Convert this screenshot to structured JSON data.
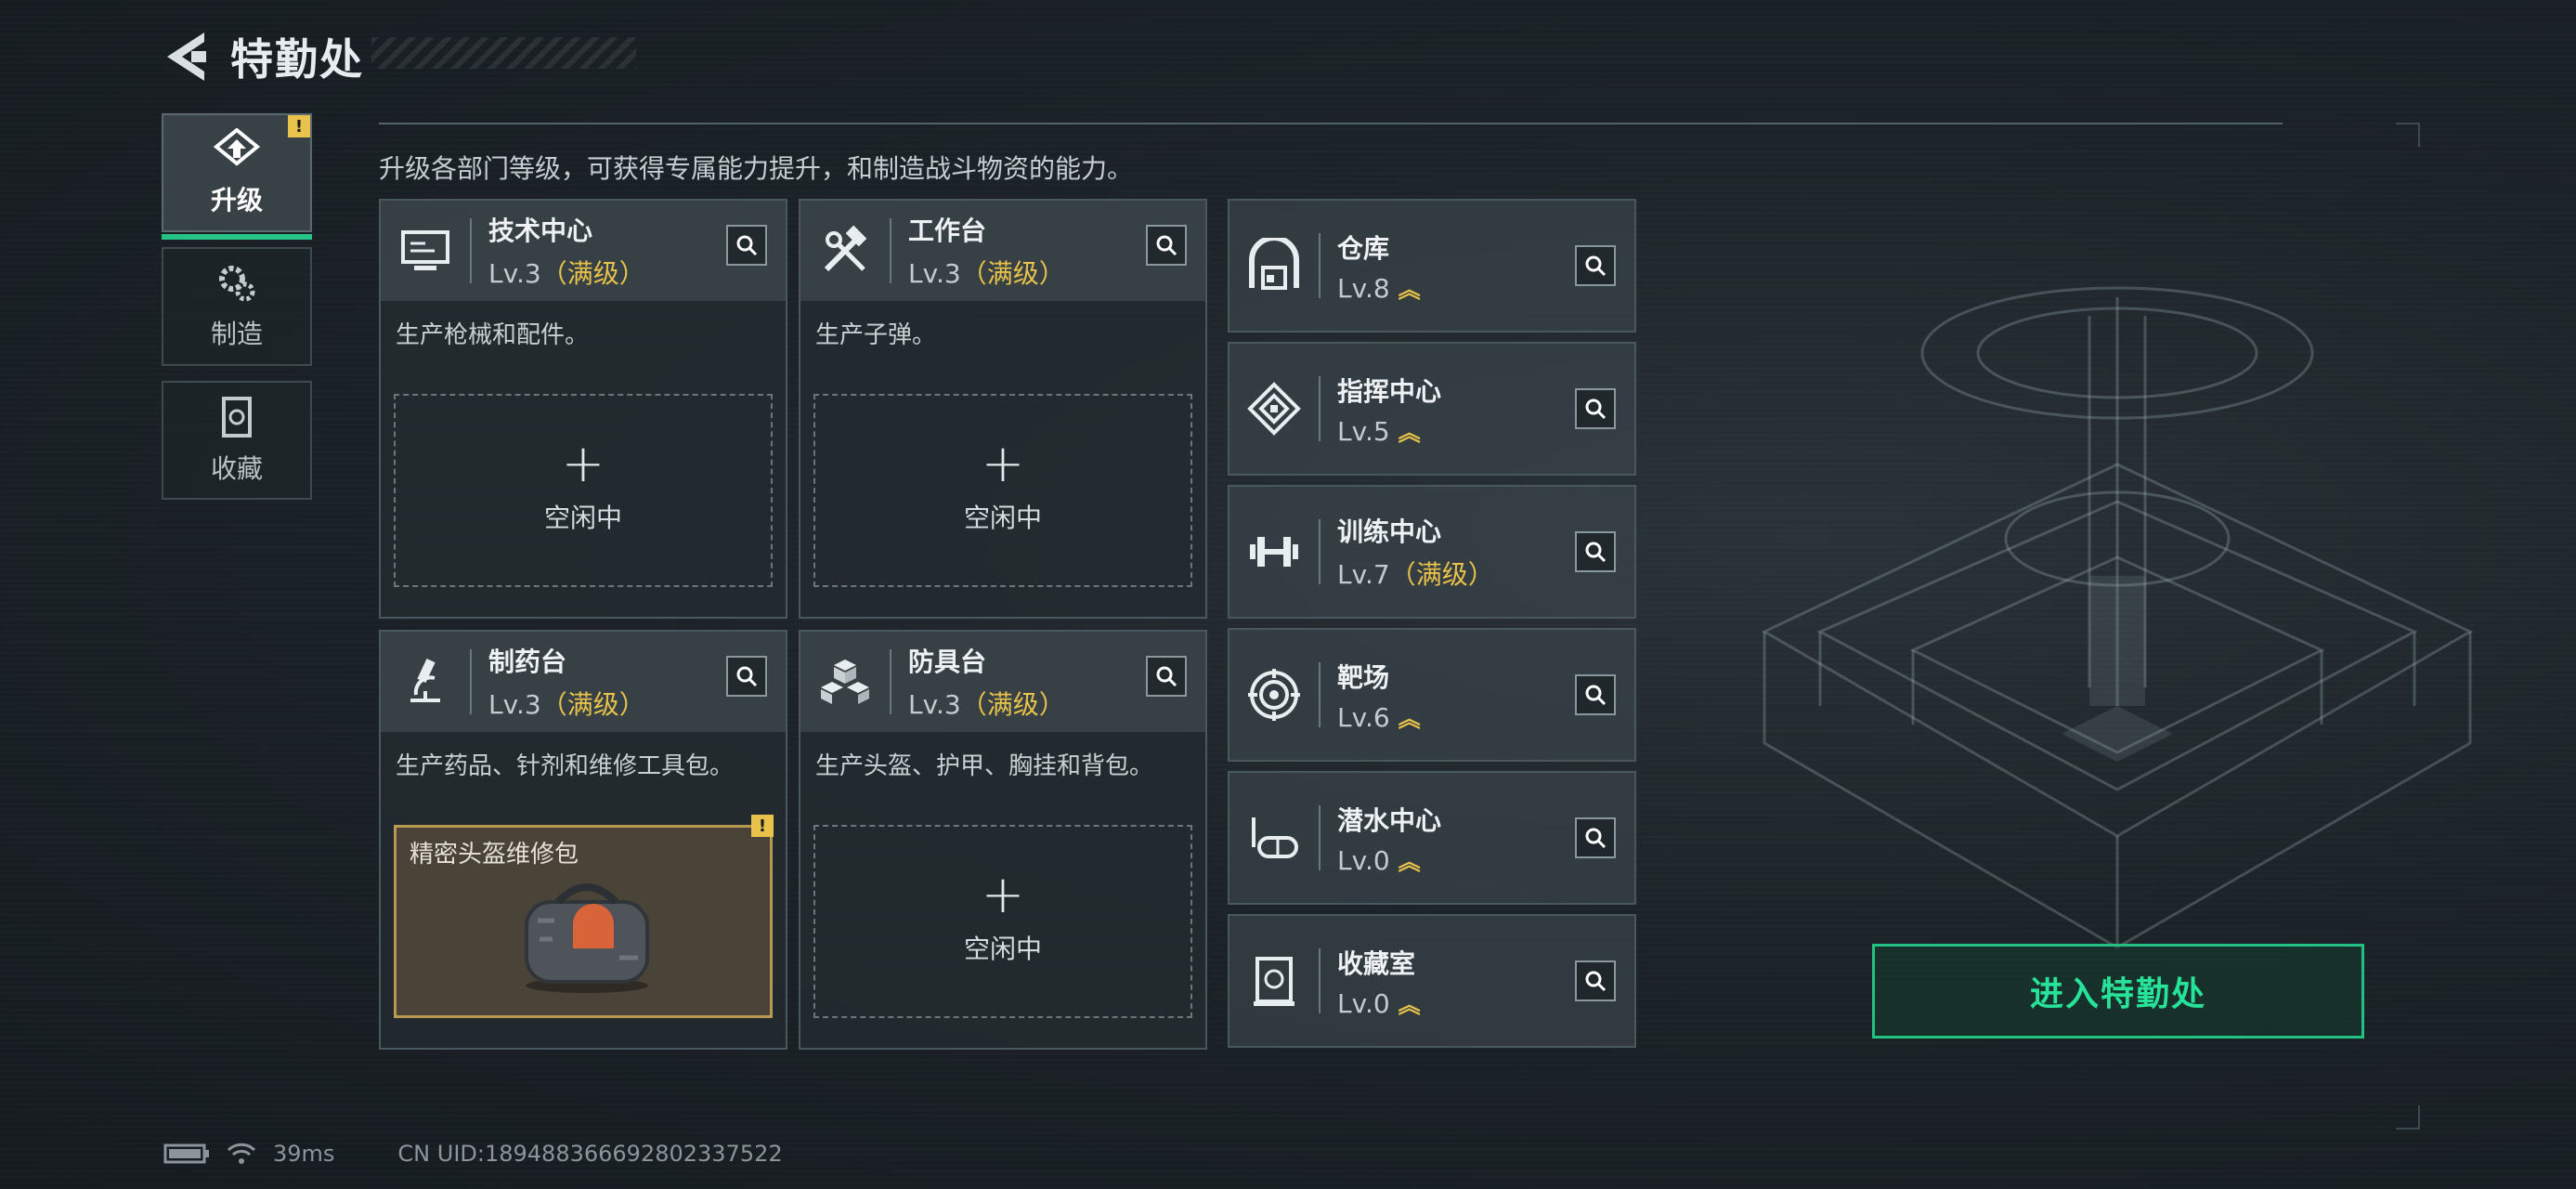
{
  "header": {
    "title": "特勤处",
    "back_icon": "back-chevron-icon"
  },
  "sidebar": {
    "items": [
      {
        "label": "升级",
        "icon": "upgrade-icon",
        "active": true,
        "alert": "!"
      },
      {
        "label": "制造",
        "icon": "gears-icon",
        "active": false
      },
      {
        "label": "收藏",
        "icon": "collection-icon",
        "active": false
      }
    ]
  },
  "description": "升级各部门等级，可获得专属能力提升，和制造战斗物资的能力。",
  "workshops": [
    {
      "name": "技术中心",
      "level": "Lv.3",
      "max": "（满级）",
      "desc": "生产枪械和配件。",
      "slot": {
        "plus": "+",
        "status": "空闲中"
      }
    },
    {
      "name": "工作台",
      "level": "Lv.3",
      "max": "（满级）",
      "desc": "生产子弹。",
      "slot": {
        "plus": "+",
        "status": "空闲中"
      }
    },
    {
      "name": "制药台",
      "level": "Lv.3",
      "max": "（满级）",
      "desc": "生产药品、针剂和维修工具包。",
      "slot": {
        "item": "精密头盔维修包",
        "alert": "!"
      }
    },
    {
      "name": "防具台",
      "level": "Lv.3",
      "max": "（满级）",
      "desc": "生产头盔、护甲、胸挂和背包。",
      "slot": {
        "plus": "+",
        "status": "空闲中"
      }
    }
  ],
  "facilities": [
    {
      "name": "仓库",
      "level": "Lv.8",
      "suffix": "︽"
    },
    {
      "name": "指挥中心",
      "level": "Lv.5",
      "suffix": "︽"
    },
    {
      "name": "训练中心",
      "level": "Lv.7",
      "max": "（满级）"
    },
    {
      "name": "靶场",
      "level": "Lv.6",
      "suffix": "︽"
    },
    {
      "name": "潜水中心",
      "level": "Lv.0",
      "suffix": "︽"
    },
    {
      "name": "收藏室",
      "level": "Lv.0",
      "suffix": "︽"
    }
  ],
  "enter_button": "进入特勤处",
  "status_bar": {
    "ping": "39ms",
    "uid": "CN UID:18948836669280233752​2"
  },
  "colors": {
    "accent": "#27c387",
    "gold": "#e8c24b"
  }
}
